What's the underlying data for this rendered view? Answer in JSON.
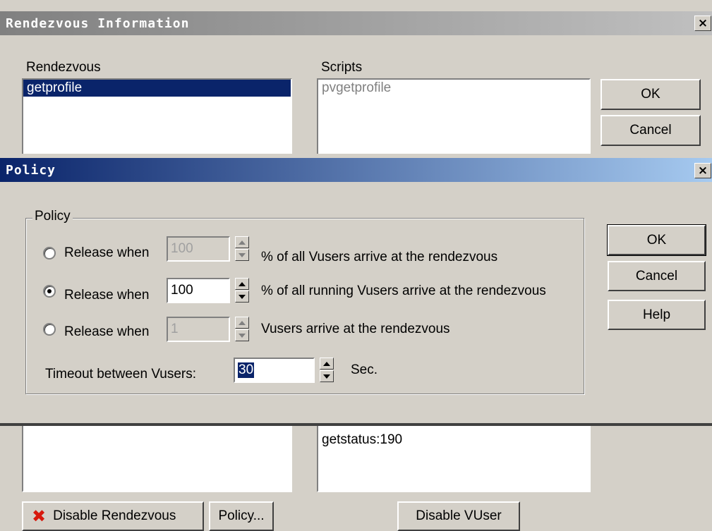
{
  "rendezvous_dialog": {
    "title": "Rendezvous Information",
    "close_glyph": "×",
    "rendezvous_label": "Rendezvous",
    "rendezvous_items": [
      "getprofile"
    ],
    "scripts_label": "Scripts",
    "scripts_items": [
      "pvgetprofile"
    ],
    "ok_label": "OK",
    "cancel_label": "Cancel",
    "lower_list_item": "getstatus:190",
    "disable_rendezvous_label": "Disable Rendezvous",
    "policy_button_label": "Policy...",
    "disable_vuser_label": "Disable VUser"
  },
  "policy_dialog": {
    "title": "Policy",
    "close_glyph": "×",
    "group_label": "Policy",
    "options": [
      {
        "prefix": "Release when",
        "value": "100",
        "suffix": "% of all Vusers arrive at the rendezvous",
        "selected": false,
        "enabled": false
      },
      {
        "prefix": "Release when",
        "value": "100",
        "suffix": "% of all running Vusers arrive at the rendezvous",
        "selected": true,
        "enabled": true
      },
      {
        "prefix": "Release when",
        "value": "1",
        "suffix": "Vusers arrive at the rendezvous",
        "selected": false,
        "enabled": false
      }
    ],
    "timeout_label": "Timeout between Vusers:",
    "timeout_value": "30",
    "timeout_unit": "Sec.",
    "ok_label": "OK",
    "cancel_label": "Cancel",
    "help_label": "Help"
  },
  "colors": {
    "title_active_start": "#0a246a",
    "title_active_end": "#a6caf0",
    "title_inactive_start": "#808080",
    "title_inactive_end": "#c0c0c0",
    "selection": "#0a246a",
    "error_x": "#d7190d"
  }
}
